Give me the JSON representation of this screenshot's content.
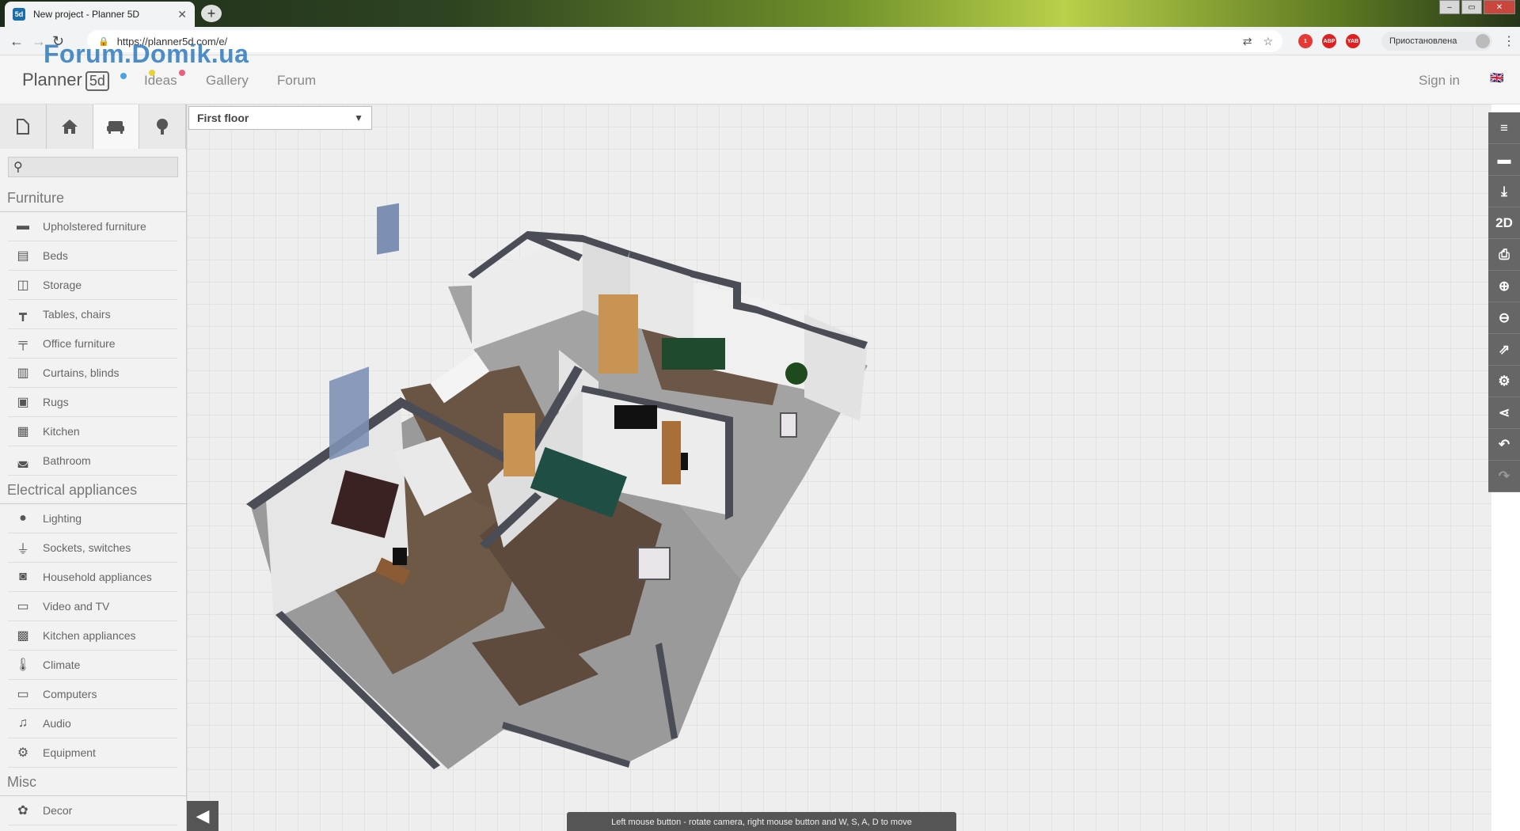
{
  "browser": {
    "tab_title": "New project - Planner 5D",
    "tab_favicon": "5d",
    "tab_close": "✕",
    "new_tab": "+",
    "url": "https://planner5d.com/e/",
    "profile_label": "Приостановлена",
    "window_controls": [
      "–",
      "▭",
      "✕"
    ],
    "extensions": [
      {
        "name": "extension-badge-icon",
        "text": "1",
        "color": "#e53935"
      },
      {
        "name": "adblock-icon",
        "text": "ABP",
        "color": "#e02020"
      },
      {
        "name": "yandex-icon",
        "text": "YAB",
        "color": "#e02020"
      }
    ]
  },
  "watermark": "Forum.Domik.ua",
  "app_header": {
    "logo_text": "Planner",
    "logo_badge": "5d",
    "nav": [
      "Ideas",
      "Gallery",
      "Forum"
    ],
    "sign_in": "Sign in",
    "lang_flag": "🇬🇧"
  },
  "sidebar": {
    "tabs": [
      "file-icon",
      "house-icon",
      "sofa-icon",
      "tree-icon"
    ],
    "search_placeholder": "",
    "sections": [
      {
        "title": "Furniture",
        "items": [
          "Upholstered furniture",
          "Beds",
          "Storage",
          "Tables, chairs",
          "Office furniture",
          "Curtains, blinds",
          "Rugs",
          "Kitchen",
          "Bathroom"
        ]
      },
      {
        "title": "Electrical appliances",
        "items": [
          "Lighting",
          "Sockets, switches",
          "Household appliances",
          "Video and TV",
          "Kitchen appliances",
          "Climate",
          "Computers",
          "Audio",
          "Equipment"
        ]
      },
      {
        "title": "Misc",
        "items": [
          "Decor"
        ]
      }
    ]
  },
  "viewport": {
    "floor_selector": "First floor",
    "hint": "Left mouse button - rotate camera, right mouse button and W, S, A, D to move"
  },
  "right_toolbar": [
    {
      "name": "menu-icon",
      "glyph": "≡"
    },
    {
      "name": "folder-icon",
      "glyph": "▬"
    },
    {
      "name": "download-icon",
      "glyph": "⤓"
    },
    {
      "name": "view-2d-button",
      "glyph": "2D"
    },
    {
      "name": "print-icon",
      "glyph": "⎙"
    },
    {
      "name": "zoom-in-icon",
      "glyph": "⊕"
    },
    {
      "name": "zoom-out-icon",
      "glyph": "⊖"
    },
    {
      "name": "external-link-icon",
      "glyph": "⇗"
    },
    {
      "name": "settings-icon",
      "glyph": "⚙"
    },
    {
      "name": "share-icon",
      "glyph": "⋖"
    },
    {
      "name": "undo-icon",
      "glyph": "↶"
    },
    {
      "name": "redo-icon",
      "glyph": "↷"
    }
  ]
}
